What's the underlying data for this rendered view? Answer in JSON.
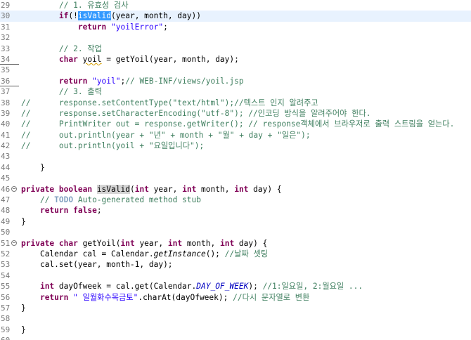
{
  "editor": {
    "lines": [
      {
        "num": "29",
        "indent": "        ",
        "tokens": [
          {
            "t": "// 1. 유효성 검사",
            "c": "cm"
          }
        ]
      },
      {
        "num": "30",
        "indent": "        ",
        "current": true,
        "tokens": [
          {
            "t": "if",
            "c": "kw"
          },
          {
            "t": "(!",
            "c": ""
          },
          {
            "t": "isValid",
            "c": "sel"
          },
          {
            "t": "(year, month, day))",
            "c": ""
          }
        ]
      },
      {
        "num": "31",
        "indent": "            ",
        "tokens": [
          {
            "t": "return",
            "c": "kw"
          },
          {
            "t": " ",
            "c": ""
          },
          {
            "t": "\"yoilError\"",
            "c": "str"
          },
          {
            "t": ";",
            "c": ""
          }
        ]
      },
      {
        "num": "32",
        "indent": "",
        "tokens": []
      },
      {
        "num": "33",
        "indent": "        ",
        "tokens": [
          {
            "t": "// 2. 작업",
            "c": "cm"
          }
        ]
      },
      {
        "num": "34",
        "indent": "        ",
        "changed": true,
        "tokens": [
          {
            "t": "char",
            "c": "kw"
          },
          {
            "t": " ",
            "c": ""
          },
          {
            "t": "yoil",
            "c": "squiggle"
          },
          {
            "t": " = getYoil(year, month, day);",
            "c": ""
          }
        ]
      },
      {
        "num": "35",
        "indent": "",
        "tokens": []
      },
      {
        "num": "36",
        "indent": "        ",
        "changed": true,
        "tokens": [
          {
            "t": "return",
            "c": "kw"
          },
          {
            "t": " ",
            "c": ""
          },
          {
            "t": "\"yoil\"",
            "c": "str"
          },
          {
            "t": ";",
            "c": ""
          },
          {
            "t": "// WEB-INF/views/yoil.jsp",
            "c": "cm"
          }
        ]
      },
      {
        "num": "37",
        "indent": "        ",
        "tokens": [
          {
            "t": "// 3. 출력",
            "c": "cm"
          }
        ]
      },
      {
        "num": "38",
        "indent": "",
        "tokens": [
          {
            "t": "//      response.setContentType(\"text/html\");//텍스트 인지 알려주고",
            "c": "cm"
          }
        ]
      },
      {
        "num": "39",
        "indent": "",
        "tokens": [
          {
            "t": "//      response.setCharacterEncoding(\"utf-8\"); //인코딩 방식을 알려주어야 한다.",
            "c": "cm"
          }
        ]
      },
      {
        "num": "40",
        "indent": "",
        "tokens": [
          {
            "t": "//      PrintWriter out = response.getWriter(); // response객체에서 브라우저로 출력 스트림을 얻는다.",
            "c": "cm"
          }
        ]
      },
      {
        "num": "41",
        "indent": "",
        "tokens": [
          {
            "t": "//      out.println(year + \"년\" + month + \"월\" + day + \"일은\");",
            "c": "cm"
          }
        ]
      },
      {
        "num": "42",
        "indent": "",
        "tokens": [
          {
            "t": "//      out.println(yoil + \"요일입니다\");",
            "c": "cm"
          }
        ]
      },
      {
        "num": "43",
        "indent": "",
        "tokens": []
      },
      {
        "num": "44",
        "indent": "    ",
        "tokens": [
          {
            "t": "}",
            "c": ""
          }
        ]
      },
      {
        "num": "45",
        "indent": "",
        "tokens": []
      },
      {
        "num": "46",
        "indent": "",
        "fold": true,
        "tokens": [
          {
            "t": "private",
            "c": "kw"
          },
          {
            "t": " ",
            "c": ""
          },
          {
            "t": "boolean",
            "c": "kw"
          },
          {
            "t": " ",
            "c": ""
          },
          {
            "t": "isValid",
            "c": "occ"
          },
          {
            "t": "(",
            "c": ""
          },
          {
            "t": "int",
            "c": "kw"
          },
          {
            "t": " year, ",
            "c": ""
          },
          {
            "t": "int",
            "c": "kw"
          },
          {
            "t": " month, ",
            "c": ""
          },
          {
            "t": "int",
            "c": "kw"
          },
          {
            "t": " day) {",
            "c": ""
          }
        ]
      },
      {
        "num": "47",
        "indent": "    ",
        "tokens": [
          {
            "t": "// ",
            "c": "cm"
          },
          {
            "t": "TODO",
            "c": "todo"
          },
          {
            "t": " Auto-generated method stub",
            "c": "cm"
          }
        ]
      },
      {
        "num": "48",
        "indent": "    ",
        "tokens": [
          {
            "t": "return",
            "c": "kw"
          },
          {
            "t": " ",
            "c": ""
          },
          {
            "t": "false",
            "c": "kw"
          },
          {
            "t": ";",
            "c": ""
          }
        ]
      },
      {
        "num": "49",
        "indent": "",
        "tokens": [
          {
            "t": "}",
            "c": ""
          }
        ]
      },
      {
        "num": "50",
        "indent": "",
        "tokens": []
      },
      {
        "num": "51",
        "indent": "",
        "fold": true,
        "tokens": [
          {
            "t": "private",
            "c": "kw"
          },
          {
            "t": " ",
            "c": ""
          },
          {
            "t": "char",
            "c": "kw"
          },
          {
            "t": " getYoil(",
            "c": ""
          },
          {
            "t": "int",
            "c": "kw"
          },
          {
            "t": " year, ",
            "c": ""
          },
          {
            "t": "int",
            "c": "kw"
          },
          {
            "t": " month, ",
            "c": ""
          },
          {
            "t": "int",
            "c": "kw"
          },
          {
            "t": " day) {",
            "c": ""
          }
        ]
      },
      {
        "num": "52",
        "indent": "    ",
        "tokens": [
          {
            "t": "Calendar cal = Calendar.",
            "c": ""
          },
          {
            "t": "getInstance",
            "c": "static-method"
          },
          {
            "t": "(); ",
            "c": ""
          },
          {
            "t": "//날짜 셋팅",
            "c": "cm"
          }
        ]
      },
      {
        "num": "53",
        "indent": "    ",
        "tokens": [
          {
            "t": "cal.set(year, month-1, day);",
            "c": ""
          }
        ]
      },
      {
        "num": "54",
        "indent": "",
        "tokens": []
      },
      {
        "num": "55",
        "indent": "    ",
        "tokens": [
          {
            "t": "int",
            "c": "kw"
          },
          {
            "t": " dayOfweek = cal.get(Calendar.",
            "c": ""
          },
          {
            "t": "DAY_OF_WEEK",
            "c": "static-field"
          },
          {
            "t": "); ",
            "c": ""
          },
          {
            "t": "//1:일요일, 2:월요일 ...",
            "c": "cm"
          }
        ]
      },
      {
        "num": "56",
        "indent": "    ",
        "tokens": [
          {
            "t": "return",
            "c": "kw"
          },
          {
            "t": " ",
            "c": ""
          },
          {
            "t": "\" 일월화수목금토\"",
            "c": "str"
          },
          {
            "t": ".charAt(dayOfweek); ",
            "c": ""
          },
          {
            "t": "//다시 문자열로 변환",
            "c": "cm"
          }
        ]
      },
      {
        "num": "57",
        "indent": "",
        "tokens": [
          {
            "t": "}",
            "c": ""
          }
        ]
      },
      {
        "num": "58",
        "indent": "",
        "tokens": []
      },
      {
        "num": "59",
        "indent": "",
        "tokens": [
          {
            "t": "}",
            "c": ""
          }
        ]
      },
      {
        "num": "60",
        "indent": "",
        "tokens": []
      }
    ],
    "colors": {
      "keyword": "#7f0055",
      "comment": "#3f7f5f",
      "string": "#2a00ff",
      "selection": "#3399ff",
      "current_line": "#e8f2fe",
      "line_number": "#787878"
    }
  }
}
